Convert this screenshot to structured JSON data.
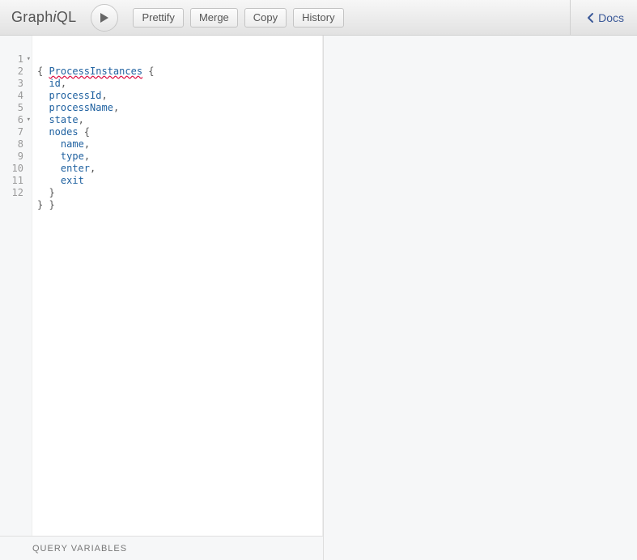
{
  "app": {
    "title_prefix": "Graph",
    "title_i": "i",
    "title_suffix": "QL"
  },
  "toolbar": {
    "prettify": "Prettify",
    "merge": "Merge",
    "copy": "Copy",
    "history": "History",
    "docs": "Docs"
  },
  "editor": {
    "line_numbers": [
      "1",
      "2",
      "3",
      "4",
      "5",
      "6",
      "7",
      "8",
      "9",
      "10",
      "11",
      "12"
    ],
    "fold_lines": [
      1,
      6
    ],
    "code": {
      "l1_open": "{ ",
      "l1_field": "ProcessInstances",
      "l1_rest": " {",
      "l2_field": "id",
      "l3_field": "processId",
      "l4_field": "processName",
      "l5_field": "state",
      "l6_field": "nodes",
      "l6_rest": " {",
      "l7_field": "name",
      "l8_field": "type",
      "l9_field": "enter",
      "l10_field": "exit",
      "l11": "  }",
      "l12": "} }",
      "comma": ","
    }
  },
  "footer": {
    "variables_label": "Query Variables"
  }
}
